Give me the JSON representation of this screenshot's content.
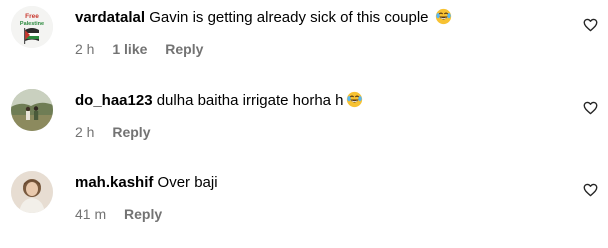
{
  "comments": [
    {
      "username": "vardatalal",
      "text": "Gavin is getting already sick of this couple",
      "emoji": "laughing-tears-emoji",
      "time": "2 h",
      "likes": "1 like",
      "reply": "Reply",
      "avatar_text": "Free Palestine",
      "heart_icon": "heart-outline-icon"
    },
    {
      "username": "do_haa123",
      "text": "dulha baitha irrigate horha h",
      "emoji": "laughing-tears-emoji",
      "time": "2 h",
      "reply": "Reply",
      "heart_icon": "heart-outline-icon"
    },
    {
      "username": "mah.kashif",
      "text": "Over baji",
      "time": "41 m",
      "reply": "Reply",
      "heart_icon": "heart-outline-icon"
    }
  ],
  "colors": {
    "text": "#000000",
    "meta": "#737373",
    "background": "#ffffff"
  }
}
